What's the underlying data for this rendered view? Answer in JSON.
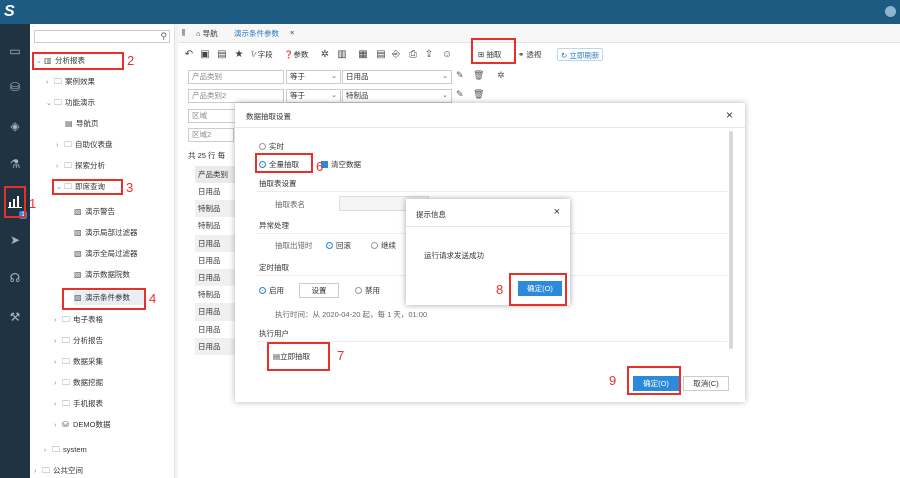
{
  "topbar": {
    "logo": "S"
  },
  "leftnav": {
    "badge": "1"
  },
  "tree": {
    "search_placeholder": "",
    "items": [
      {
        "label": "分析报表"
      },
      {
        "label": "案例效果"
      },
      {
        "label": "功能演示"
      },
      {
        "label": "导航页"
      },
      {
        "label": "自助仪表盘"
      },
      {
        "label": "探索分析"
      },
      {
        "label": "即席查询"
      },
      {
        "label": "演示警告"
      },
      {
        "label": "演示局部过滤器"
      },
      {
        "label": "演示全局过滤器"
      },
      {
        "label": "演示数据院数"
      },
      {
        "label": "演示条件参数"
      },
      {
        "label": "电子表格"
      },
      {
        "label": "分析报告"
      },
      {
        "label": "数据采集"
      },
      {
        "label": "数据挖掘"
      },
      {
        "label": "手机报表"
      },
      {
        "label": "DEMO数据"
      },
      {
        "label": "system"
      },
      {
        "label": "公共空间"
      }
    ]
  },
  "tabs": {
    "nav": "导航",
    "current": "演示条件参数",
    "close": "×"
  },
  "toolbar": {
    "field": "字段",
    "param": "参数",
    "extract": "抽取",
    "pivot": "透视",
    "refresh": "立即刷新"
  },
  "filters": [
    {
      "field": "产品类别",
      "op": "等于",
      "value": "日用品"
    },
    {
      "field": "产品类别2",
      "op": "等于",
      "value": "特制品"
    },
    {
      "field": "区域",
      "op": "等于",
      "value": ""
    },
    {
      "field": "区域2",
      "op": "",
      "value": ""
    }
  ],
  "grid": {
    "count": "共 25 行  每",
    "header": "产品类别",
    "rows": [
      "日用品",
      "特制品",
      "特制品",
      "日用品",
      "日用品",
      "日用品",
      "特制品",
      "日用品",
      "日用品",
      "日用品"
    ]
  },
  "dialog": {
    "title": "数据抽取设置",
    "close": "×",
    "realtime": "实时",
    "full_extract": "全量抽取",
    "clear_data": "清空数据",
    "table_settings": "抽取表设置",
    "table_name": "抽取表名",
    "exception": "异常处理",
    "on_error": "抽取出错时",
    "rollback": "回滚",
    "continue": "继续",
    "schedule": "定时抽取",
    "enable": "启用",
    "settings": "设置",
    "disable": "禁用",
    "exec_time": "执行时间：从 2020-04-20 起，每 1 天，01:00",
    "exec_user": "执行用户",
    "extract_now": "立即抽取",
    "ok": "确定(O)",
    "cancel": "取消(C)"
  },
  "popup": {
    "title": "提示信息",
    "close": "×",
    "message": "运行请求发送成功",
    "ok": "确定(O)"
  },
  "annotations": [
    "1",
    "2",
    "3",
    "4",
    "6",
    "7",
    "8",
    "9"
  ],
  "colors": {
    "accent": "#2b8ad9",
    "highlight": "#e8302a",
    "topbar": "#1e5b82",
    "nav": "#1f3342"
  }
}
